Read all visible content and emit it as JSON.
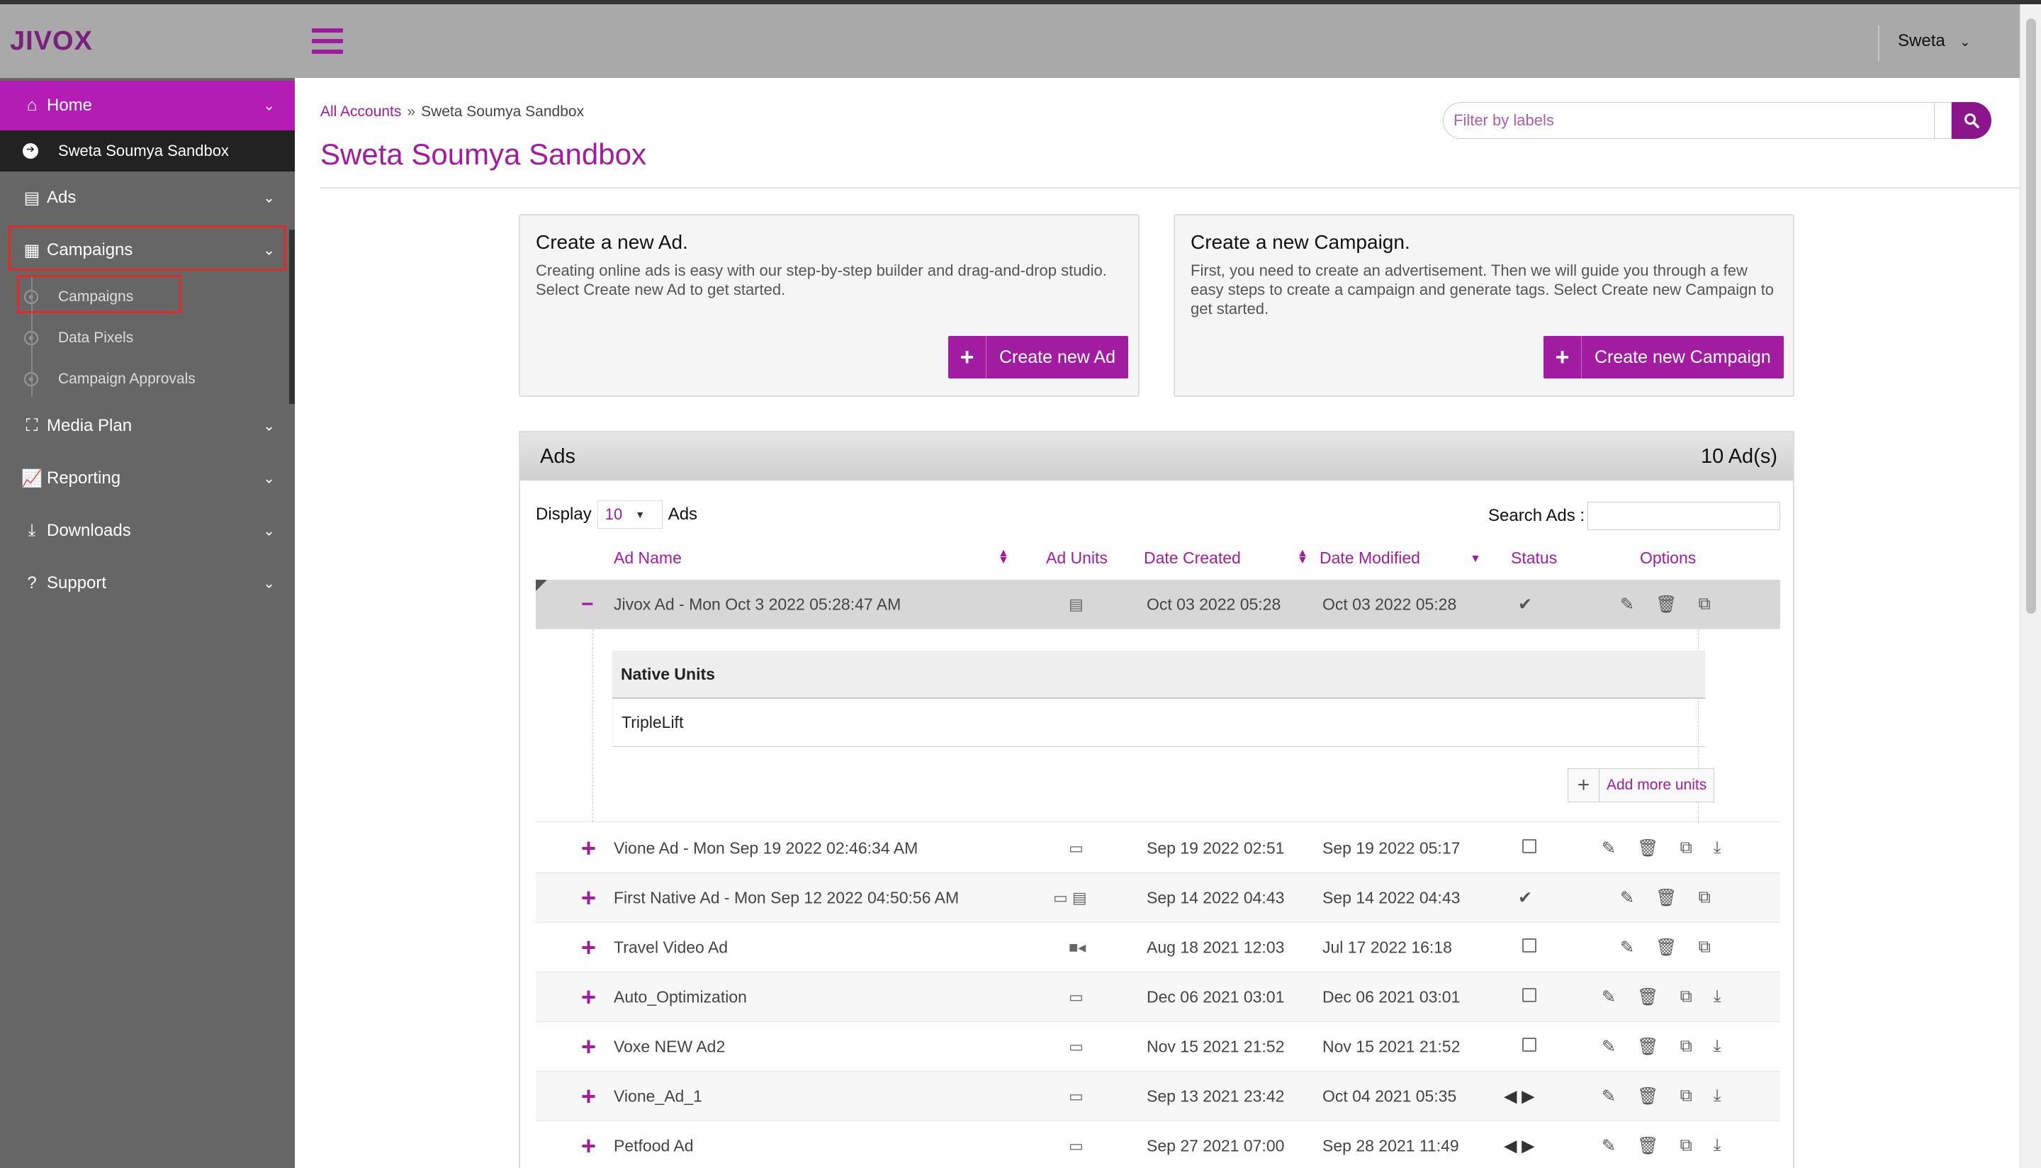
{
  "app": {
    "logo": "JIVOX",
    "user": "Sweta"
  },
  "sidebar": {
    "home": "Home",
    "current_account": "Sweta Soumya Sandbox",
    "items": [
      {
        "label": "Ads"
      },
      {
        "label": "Campaigns"
      },
      {
        "label": "Media Plan"
      },
      {
        "label": "Reporting"
      },
      {
        "label": "Downloads"
      },
      {
        "label": "Support"
      }
    ],
    "campaign_sub": [
      "Campaigns",
      "Data Pixels",
      "Campaign Approvals"
    ]
  },
  "breadcrumb": {
    "root": "All Accounts",
    "separator": "»",
    "current": "Sweta Soumya Sandbox"
  },
  "page_title": "Sweta Soumya Sandbox",
  "filter": {
    "placeholder": "Filter by labels"
  },
  "cards": {
    "ad": {
      "title": "Create a new Ad.",
      "text": "Creating online ads is easy with our step-by-step builder and drag-and-drop studio. Select Create new Ad to get started.",
      "button": "Create new Ad"
    },
    "campaign": {
      "title": "Create a new Campaign.",
      "text": "First, you need to create an advertisement. Then we will guide you through a few easy steps to create a campaign and generate tags. Select Create new Campaign to get started.",
      "button": "Create new Campaign"
    }
  },
  "ads": {
    "title": "Ads",
    "count": "10 Ad(s)",
    "display_label": "Display",
    "display_value": "10",
    "display_suffix": "Ads",
    "search_label": "Search Ads :",
    "columns": [
      "Ad Name",
      "Ad Units",
      "Date Created",
      "Date Modified",
      "Status",
      "Options"
    ],
    "expanded": {
      "header": "Native Units",
      "unit": "TripleLift",
      "add_more": "Add more units"
    },
    "rows": [
      {
        "name": "Jivox Ad - Mon Oct 3 2022 05:28:47 AM",
        "created": "Oct 03 2022 05:28",
        "modified": "Oct 03 2022 05:28",
        "units": "native-icon",
        "status": "check",
        "expanded": true
      },
      {
        "name": "Vione Ad - Mon Sep 19 2022 02:46:34 AM",
        "created": "Sep 19 2022 02:51",
        "modified": "Sep 19 2022 05:17",
        "units": "display-icon",
        "status": "checkbox"
      },
      {
        "name": "First Native Ad - Mon Sep 12 2022 04:50:56 AM",
        "created": "Sep 14 2022 04:43",
        "modified": "Sep 14 2022 04:43",
        "units": "display-icon native-icon",
        "status": "check"
      },
      {
        "name": "Travel Video Ad",
        "created": "Aug 18 2021 12:03",
        "modified": "Jul 17 2022 16:18",
        "units": "video-icon",
        "status": "checkbox"
      },
      {
        "name": "Auto_Optimization",
        "created": "Dec 06 2021 03:01",
        "modified": "Dec 06 2021 03:01",
        "units": "display-icon",
        "status": "checkbox"
      },
      {
        "name": "Voxe NEW Ad2",
        "created": "Nov 15 2021 21:52",
        "modified": "Nov 15 2021 21:52",
        "units": "display-icon",
        "status": "checkbox"
      },
      {
        "name": "Vione_Ad_1",
        "created": "Sep 13 2021 23:42",
        "modified": "Oct 04 2021 05:35",
        "units": "display-icon",
        "status": "arrows"
      },
      {
        "name": "Petfood Ad",
        "created": "Sep 27 2021 07:00",
        "modified": "Sep 28 2021 11:49",
        "units": "display-icon",
        "status": "arrows"
      }
    ]
  },
  "colors": {
    "brand": "#a21ca2",
    "sidebar": "#666666",
    "header": "#a9a9a9",
    "highlight": "#e02b2b"
  }
}
